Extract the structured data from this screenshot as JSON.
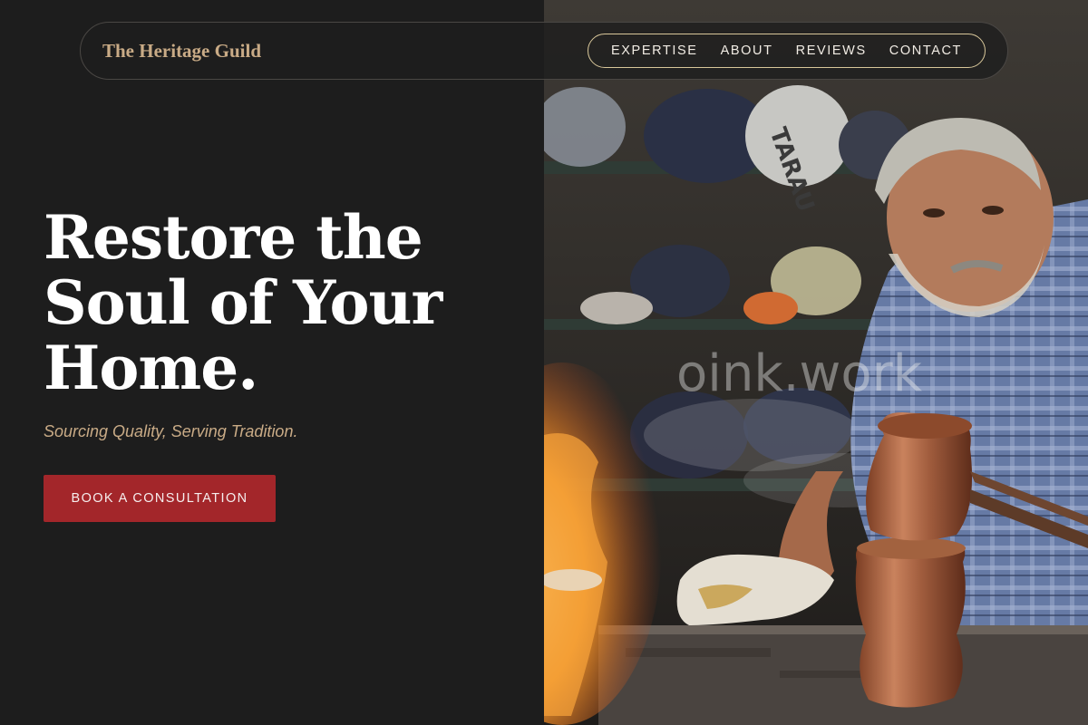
{
  "brand": {
    "name": "The Heritage Guild"
  },
  "nav": {
    "items": [
      {
        "label": "EXPERTISE"
      },
      {
        "label": "ABOUT"
      },
      {
        "label": "REVIEWS"
      },
      {
        "label": "CONTACT"
      }
    ]
  },
  "hero": {
    "headline_lines": [
      "Restore the",
      "Soul of Your",
      "Home."
    ],
    "subtitle": "Sourcing Quality, Serving Tradition.",
    "cta_label": "BOOK A CONSULTATION",
    "watermark": "oink.work",
    "photo_sack_text": "TARAU"
  },
  "colors": {
    "background": "#1d1d1d",
    "accent_gold": "#c9ab86",
    "cta_red": "#a3262a",
    "text": "#ffffff"
  }
}
